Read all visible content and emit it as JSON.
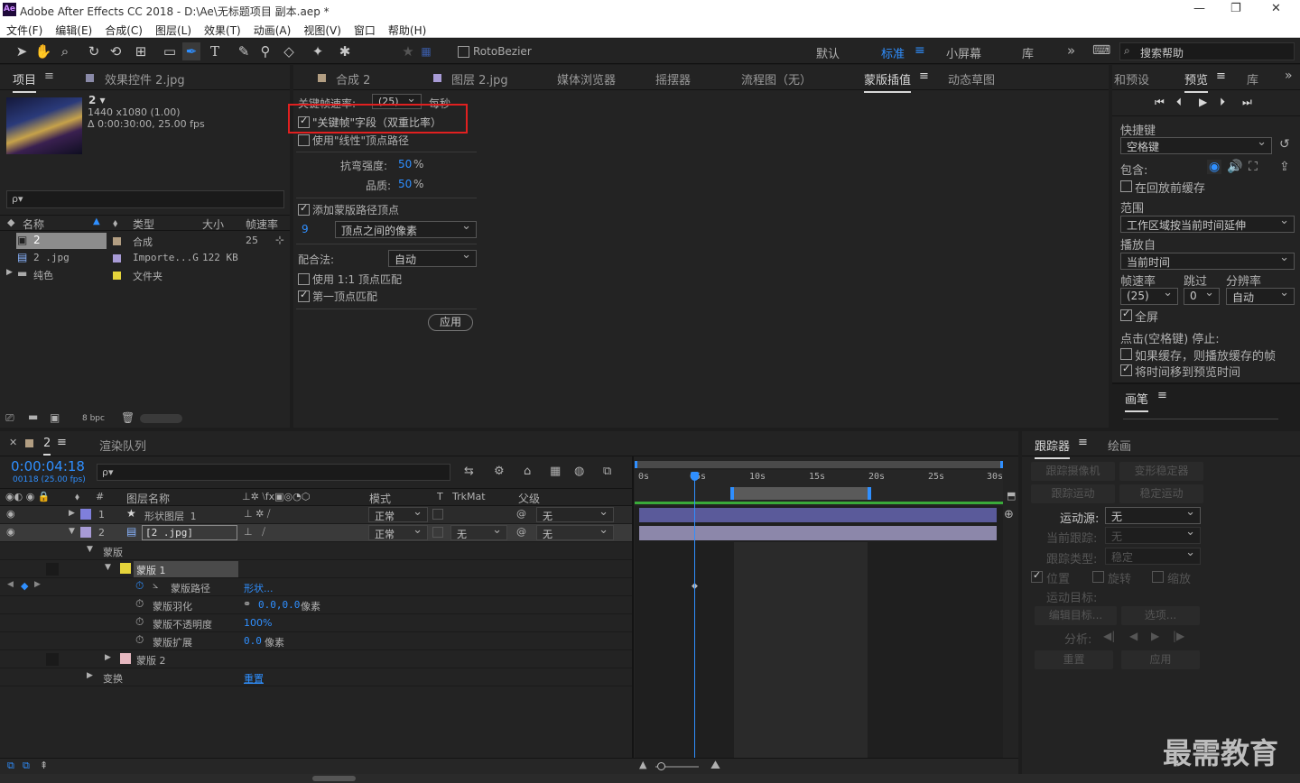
{
  "app": {
    "title": "Adobe After Effects CC 2018 - D:\\Ae\\无标题项目 副本.aep *",
    "logo": "Ae"
  },
  "menu": [
    "文件(F)",
    "编辑(E)",
    "合成(C)",
    "图层(L)",
    "效果(T)",
    "动画(A)",
    "视图(V)",
    "窗口",
    "帮助(H)"
  ],
  "toolbar": {
    "rotobezier": "RotoBezier",
    "workspaces": [
      "默认",
      "标准",
      "小屏幕",
      "库"
    ],
    "search_placeholder": "搜索帮助"
  },
  "project": {
    "tabs": [
      "项目",
      "效果控件 2.jpg"
    ],
    "item_name": "2 ▾",
    "item_dims": "1440 x1080 (1.00)",
    "item_duration": "Δ 0:00:30:00, 25.00 fps",
    "search_placeholder": "ρ▾",
    "columns": [
      "名称",
      "类型",
      "大小",
      "帧速率"
    ],
    "rows": [
      {
        "name": "2",
        "type": "合成",
        "size": "",
        "fps": "25",
        "color": "#b29e82"
      },
      {
        "name": "2 .jpg",
        "type": "Importe...G",
        "size": "122 KB",
        "fps": "",
        "color": "#a89bd6"
      },
      {
        "name": "纯色",
        "type": "文件夹",
        "size": "",
        "fps": "",
        "color": "#e5d43b"
      }
    ],
    "bpc": "8 bpc"
  },
  "center": {
    "tabs": [
      "合成 2",
      "图层 2.jpg",
      "媒体浏览器",
      "摇摆器",
      "流程图（无）",
      "蒙版插值",
      "动态草图"
    ],
    "keyframe_rate_label": "关键帧速率:",
    "keyframe_rate_value": "(25)",
    "keyframe_rate_unit": "每秒",
    "cb_keyframe_fields": "\"关键帧\"字段（双重比率）",
    "cb_linear": "使用\"线性\"顶点路径",
    "bend_label": "抗弯强度:",
    "bend_value": "50",
    "bend_unit": "%",
    "quality_label": "品质:",
    "quality_value": "50",
    "quality_unit": "%",
    "cb_add_vertices": "添加蒙版路径顶点",
    "vertex_num": "9",
    "vertex_mode": "顶点之间的像素",
    "match_label": "配合法:",
    "match_value": "自动",
    "cb_one_to_one": "使用 1:1 顶点匹配",
    "cb_first_vertex": "第一顶点匹配",
    "apply": "应用"
  },
  "preview": {
    "tabs": [
      "和预设",
      "预览",
      "库"
    ],
    "shortcut_label": "快捷键",
    "shortcut_value": "空格键",
    "include_label": "包含:",
    "cb_cache": "在回放前缓存",
    "range_label": "范围",
    "range_value": "工作区域按当前时间延伸",
    "play_from_label": "播放自",
    "play_from_value": "当前时间",
    "fps_label": "帧速率",
    "skip_label": "跳过",
    "res_label": "分辨率",
    "fps_value": "(25)",
    "skip_value": "0",
    "res_value": "自动",
    "cb_fullscreen": "全屏",
    "stop_label": "点击(空格键) 停止:",
    "cb_cached_frames": "如果缓存，则播放缓存的帧",
    "cb_move_time": "将时间移到预览时间",
    "brush_tab": "画笔"
  },
  "timeline": {
    "tabs": [
      "2",
      "渲染队列"
    ],
    "timecode": "0:00:04:18",
    "frame_info": "00118 (25.00 fps)",
    "search_placeholder": "ρ▾",
    "columns": {
      "layer_name": "图层名称",
      "mode": "模式",
      "t": "T",
      "trkmat": "TrkMat",
      "parent": "父级"
    },
    "layers": [
      {
        "num": "1",
        "name": "形状图层 1",
        "mode": "正常",
        "trkmat": "",
        "parent": "无",
        "color": "#7f7fdc"
      },
      {
        "num": "2",
        "name": "[2 .jpg]",
        "mode": "正常",
        "trkmat": "无",
        "parent": "无",
        "color": "#a89bd6"
      }
    ],
    "props": {
      "masks": "蒙版",
      "mask1": "蒙版 1",
      "mask_path": "蒙版路径",
      "mask_path_val": "形状...",
      "feather": "蒙版羽化",
      "feather_val": "0.0,0.0",
      "feather_unit": "像素",
      "opacity": "蒙版不透明度",
      "opacity_val": "100%",
      "expansion": "蒙版扩展",
      "expansion_val": "0.0",
      "expansion_unit": "像素",
      "mask2": "蒙版 2",
      "transform": "变换",
      "transform_val": "重置"
    },
    "ruler": [
      "0s",
      "05s",
      "10s",
      "15s",
      "20s",
      "25s",
      "30s"
    ]
  },
  "tracker": {
    "tabs": [
      "跟踪器",
      "绘画"
    ],
    "track_camera": "跟踪摄像机",
    "warp": "变形稳定器",
    "track_motion": "跟踪运动",
    "stabilize": "稳定运动",
    "source_label": "运动源:",
    "source_value": "无",
    "current_label": "当前跟踪:",
    "current_value": "无",
    "type_label": "跟踪类型:",
    "type_value": "稳定",
    "cb_position": "位置",
    "cb_rotation": "旋转",
    "cb_scale": "缩放",
    "target_label": "运动目标:",
    "edit_target": "编辑目标...",
    "options": "选项...",
    "analyze_label": "分析:",
    "reset": "重置",
    "apply": "应用"
  },
  "watermark": "最需教育"
}
